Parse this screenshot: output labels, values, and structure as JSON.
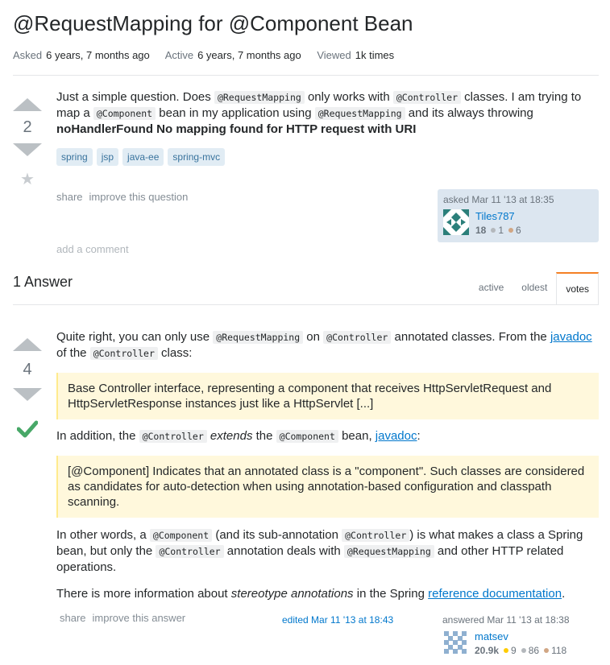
{
  "question": {
    "title": "@RequestMapping for @Component Bean",
    "meta": {
      "asked_label": "Asked",
      "asked_value": "6 years, 7 months ago",
      "active_label": "Active",
      "active_value": "6 years, 7 months ago",
      "viewed_label": "Viewed",
      "viewed_value": "1k times"
    },
    "votes": "2",
    "body": {
      "t1": "Just a simple question. Does ",
      "c1": "@RequestMapping",
      "t2": " only works with ",
      "c2": "@Controller",
      "t3": " classes. I am trying to map a ",
      "c3": "@Component",
      "t4": " bean in my application using ",
      "c4": "@RequestMapping",
      "t5": " and its always throwing ",
      "bold": "noHandlerFound No mapping found for HTTP request with URI"
    },
    "tags": [
      "spring",
      "jsp",
      "java-ee",
      "spring-mvc"
    ],
    "actions": {
      "share": "share",
      "improve": "improve this question"
    },
    "asked": {
      "label": "asked Mar 11 '13 at 18:35",
      "user": "Tiles787",
      "rep": "18",
      "silver": "1",
      "bronze": "6"
    },
    "add_comment": "add a comment"
  },
  "answers_header": "1 Answer",
  "sort_tabs": [
    "active",
    "oldest",
    "votes"
  ],
  "answer": {
    "votes": "4",
    "p1": {
      "t1": "Quite right, you can only use ",
      "c1": "@RequestMapping",
      "t2": " on ",
      "c2": "@Controller",
      "t3": " annotated classes. From the ",
      "link": "javadoc",
      "t4": " of the ",
      "c3": "@Controller",
      "t5": " class:"
    },
    "quote1": "Base Controller interface, representing a component that receives HttpServletRequest and HttpServletResponse instances just like a HttpServlet [...]",
    "p2": {
      "t1": "In addition, the ",
      "c1": "@Controller",
      "em": "extends",
      "t2": " the ",
      "c2": "@Component",
      "t3": " bean, ",
      "link": "javadoc",
      "t4": ":"
    },
    "quote2": "[@Component] Indicates that an annotated class is a \"component\". Such classes are considered as candidates for auto-detection when using annotation-based configuration and classpath scanning.",
    "p3": {
      "t1": "In other words, a ",
      "c1": "@Component",
      "t2": " (and its sub-annotation ",
      "c2": "@Controller",
      "t3": ") is what makes a class a Spring bean, but only the ",
      "c3": "@Controller",
      "t4": " annotation deals with ",
      "c4": "@RequestMapping",
      "t5": " and other HTTP related operations."
    },
    "p4": {
      "t1": "There is more information about ",
      "em": "stereotype annotations",
      "t2": " in the Spring ",
      "link": "reference documentation",
      "t3": "."
    },
    "actions": {
      "share": "share",
      "improve": "improve this answer"
    },
    "edited": "edited Mar 11 '13 at 18:43",
    "answered": {
      "label": "answered Mar 11 '13 at 18:38",
      "user": "matsev",
      "rep": "20.9k",
      "gold": "9",
      "silver": "86",
      "bronze": "118"
    }
  },
  "colors": {
    "link": "#0077cc",
    "accepted": "#48a868",
    "tab_accent": "#f48024",
    "gold": "#ffcc01",
    "silver": "#b4b8bc",
    "bronze": "#d1a684"
  }
}
